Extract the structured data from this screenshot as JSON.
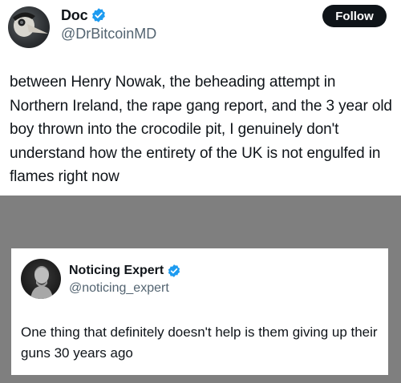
{
  "colors": {
    "verified_blue": "#1d9bf0",
    "follow_button_bg": "#0f1419",
    "handle_gray": "#536471",
    "band_gray": "#7f7f7f"
  },
  "post": {
    "author": {
      "display_name": "Doc",
      "handle": "@DrBitcoinMD",
      "verified_icon": "verified-badge-icon",
      "avatar_icon": "plague-doctor-mask-avatar"
    },
    "follow_label": "Follow",
    "text": "between Henry Nowak, the beheading attempt in Northern Ireland, the rape gang report, and the 3 year old boy thrown into the crocodile pit, I genuinely don't understand how the entirety of the UK is not engulfed in flames right now"
  },
  "quote": {
    "author": {
      "display_name": "Noticing Expert",
      "handle": "@noticing_expert",
      "verified_icon": "verified-badge-icon",
      "avatar_icon": "statue-bust-avatar"
    },
    "text": "One thing that definitely doesn't help is them giving up their guns 30 years ago"
  }
}
